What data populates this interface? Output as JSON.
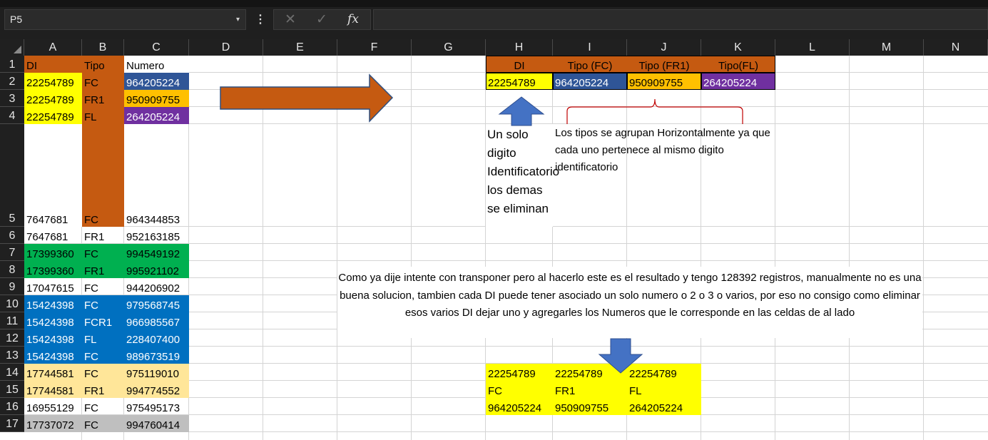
{
  "toolbar": {
    "name_box": "P5",
    "name_box_arrow": "▾",
    "more": "⋮",
    "cancel_glyph": "✕",
    "enter_glyph": "✓",
    "fx_glyph": "fx"
  },
  "columns": [
    "A",
    "B",
    "C",
    "D",
    "E",
    "F",
    "G",
    "H",
    "I",
    "J",
    "K",
    "L",
    "M",
    "N"
  ],
  "rows": [
    "1",
    "2",
    "3",
    "4",
    "5",
    "6",
    "7",
    "8",
    "9",
    "10",
    "11",
    "12",
    "13",
    "14",
    "15",
    "16",
    "17"
  ],
  "data_table": {
    "header": [
      "DI",
      "Tipo",
      "Numero"
    ],
    "rows": [
      [
        "22254789",
        "FC",
        "964205224"
      ],
      [
        "22254789",
        "FR1",
        "950909755"
      ],
      [
        "22254789",
        "FL",
        "264205224"
      ],
      [
        "7647681",
        "FC",
        "964344853"
      ],
      [
        "7647681",
        "FR1",
        "952163185"
      ],
      [
        "17399360",
        "FC",
        "994549192"
      ],
      [
        "17399360",
        "FR1",
        "995921102"
      ],
      [
        "17047615",
        "FC",
        "944206902"
      ],
      [
        "15424398",
        "FC",
        "979568745"
      ],
      [
        "15424398",
        "FCR1",
        "966985567"
      ],
      [
        "15424398",
        "FL",
        "228407400"
      ],
      [
        "15424398",
        "FC",
        "989673519"
      ],
      [
        "17744581",
        "FC",
        "975119010"
      ],
      [
        "17744581",
        "FR1",
        "994774552"
      ],
      [
        "16955129",
        "FC",
        "975495173"
      ],
      [
        "17737072",
        "FC",
        "994760414"
      ]
    ]
  },
  "target_table": {
    "headers": [
      "DI",
      "Tipo (FC)",
      "Tipo (FR1)",
      "Tipo(FL)"
    ],
    "values": [
      "22254789",
      "964205224",
      "950909755",
      "264205224"
    ]
  },
  "notes": {
    "single_digit": "Un solo digito Identificatorio los demas se eliminan",
    "grouped": "Los tipos se agrupan Horizontalmente ya que cada uno pertenece al mismo digito identificatorio",
    "problem": "Como ya dije intente con transponer pero al hacerlo este es el resultado y tengo 128392 registros, manualmente no es una buena solucion, tambien cada DI puede tener asociado un solo numero o 2 o 3 o varios, por eso no consigo como eliminar esos varios DI dejar uno y agregarles los Numeros que le corresponde en las celdas de al lado"
  },
  "transpose_result": {
    "rows": [
      [
        "22254789",
        "22254789",
        "22254789"
      ],
      [
        "FC",
        "FR1",
        "FL"
      ],
      [
        "964205224",
        "950909755",
        "264205224"
      ]
    ]
  },
  "colors": {
    "orange": "#c55a11",
    "yellow": "#ffff00",
    "blue_dark": "#2f5597",
    "amber": "#ffc000",
    "purple": "#7030a0",
    "green": "#00b050",
    "blue": "#0070c0",
    "peach": "#ffe699",
    "gray": "#bfbfbf",
    "arrow_blue": "#4472c4",
    "bracket_red": "#c00000"
  }
}
